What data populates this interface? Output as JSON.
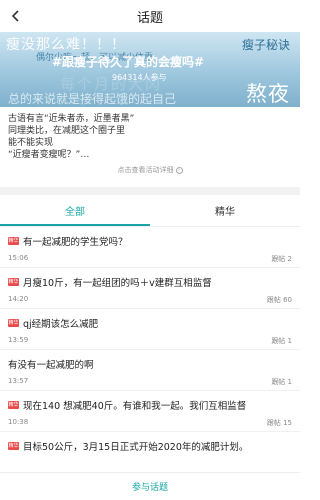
{
  "nav": {
    "title": "话题"
  },
  "banner": {
    "line1": "瘦没那么难！！！",
    "line2": "偶尔少吃一顿，可以减少体重",
    "tag": "瘦子秘诀",
    "topic": "#跟瘦子待久了真的会瘦吗#",
    "faint": "每个月的大冈",
    "count": "964314人参与",
    "bottom_text": "总的来说就是接得起饿的起自己",
    "big": "熬夜"
  },
  "description": {
    "text": "古语有言“近朱者赤，近墨者黑”\n同理类比，在减肥这个圈子里\n能不能实现\n“近瘦者变瘦呢？”…",
    "more": "点击查看活动详细"
  },
  "tabs": [
    {
      "label": "全部",
      "active": true
    },
    {
      "label": "精华",
      "active": false
    }
  ],
  "posts": [
    {
      "badge": "精华",
      "title": "有一起减肥的学生党吗？",
      "date": "15:06",
      "replies": "跟帖 2"
    },
    {
      "badge": "精华",
      "title": "月瘦10斤，有一起组团的吗＋v建群互相监督",
      "date": "14:20",
      "replies": "跟帖 60"
    },
    {
      "badge": "精华",
      "title": "qj经期该怎么减肥",
      "date": "13:59",
      "replies": "跟帖 1"
    },
    {
      "badge": "",
      "title": "有没有一起减肥的啊",
      "date": "13:57",
      "replies": "跟帖 1"
    },
    {
      "badge": "精华",
      "title": "现在140 想减肥40斤。有谁和我一起。我们互相监督",
      "date": "10:38",
      "replies": "跟帖 15"
    },
    {
      "badge": "精华",
      "title": "目标50公斤，3月15日正式开始2020年的减肥计划。",
      "date": "",
      "replies": ""
    }
  ],
  "bottom_button": "参与话题",
  "colors": {
    "accent": "#1aa6a6",
    "badge": "#e94b4b"
  }
}
